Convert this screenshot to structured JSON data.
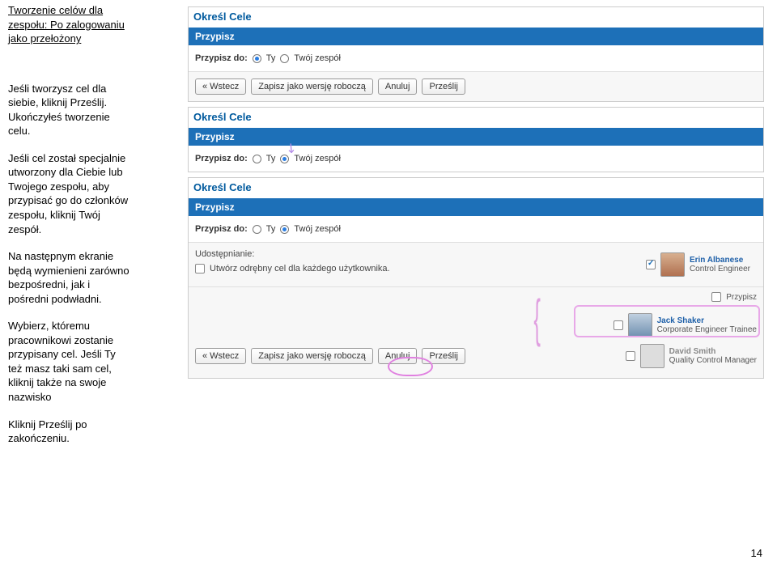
{
  "left": {
    "title_l1": "Tworzenie celów dla",
    "title_l2": "zespołu: Po zalogowaniu",
    "title_l3": "jako przełożony",
    "p2_l1": "Jeśli tworzysz cel dla",
    "p2_l2": "siebie, kliknij Prześlij.",
    "p2_l3": "Ukończyłeś tworzenie",
    "p2_l4": "celu.",
    "p3_l1": "Jeśli cel został specjalnie",
    "p3_l2": "utworzony dla Ciebie lub",
    "p3_l3": "Twojego zespołu, aby",
    "p3_l4": "przypisać go do członków",
    "p3_l5": "zespołu, kliknij Twój",
    "p3_l6": "zespół.",
    "p4_l1": "Na następnym ekranie",
    "p4_l2": "będą wymienieni zarówno",
    "p4_l3": "bezpośredni, jak i",
    "p4_l4": "pośredni podwładni.",
    "p5_l1": "Wybierz, któremu",
    "p5_l2": "pracownikowi zostanie",
    "p5_l3": "przypisany cel. Jeśli Ty",
    "p5_l4": "też masz taki sam cel,",
    "p5_l5": "kliknij także na swoje",
    "p5_l6": "nazwisko",
    "p6_l1": "Kliknij Prześlij po",
    "p6_l2": "zakończeniu."
  },
  "labels": {
    "heading": "Określ Cele",
    "przypisz": "Przypisz",
    "przypisz_do": "Przypisz do:",
    "ty": "Ty",
    "twoj_zespol": "Twój zespół",
    "udostepnianie": "Udostępnianie:",
    "utworz": "Utwórz odrębny cel dla każdego użytkownika."
  },
  "buttons": {
    "wstecz": "« Wstecz",
    "zapisz": "Zapisz jako wersję roboczą",
    "anuluj": "Anuluj",
    "przeslij": "Prześlij"
  },
  "users": {
    "u1_name": "Erin Albanese",
    "u1_role": "Control Engineer",
    "u2_name": "Jack Shaker",
    "u2_role": "Corporate Engineer Trainee",
    "u3_name": "David  Smith",
    "u3_role": "Quality Control Manager"
  },
  "page_number": "14"
}
